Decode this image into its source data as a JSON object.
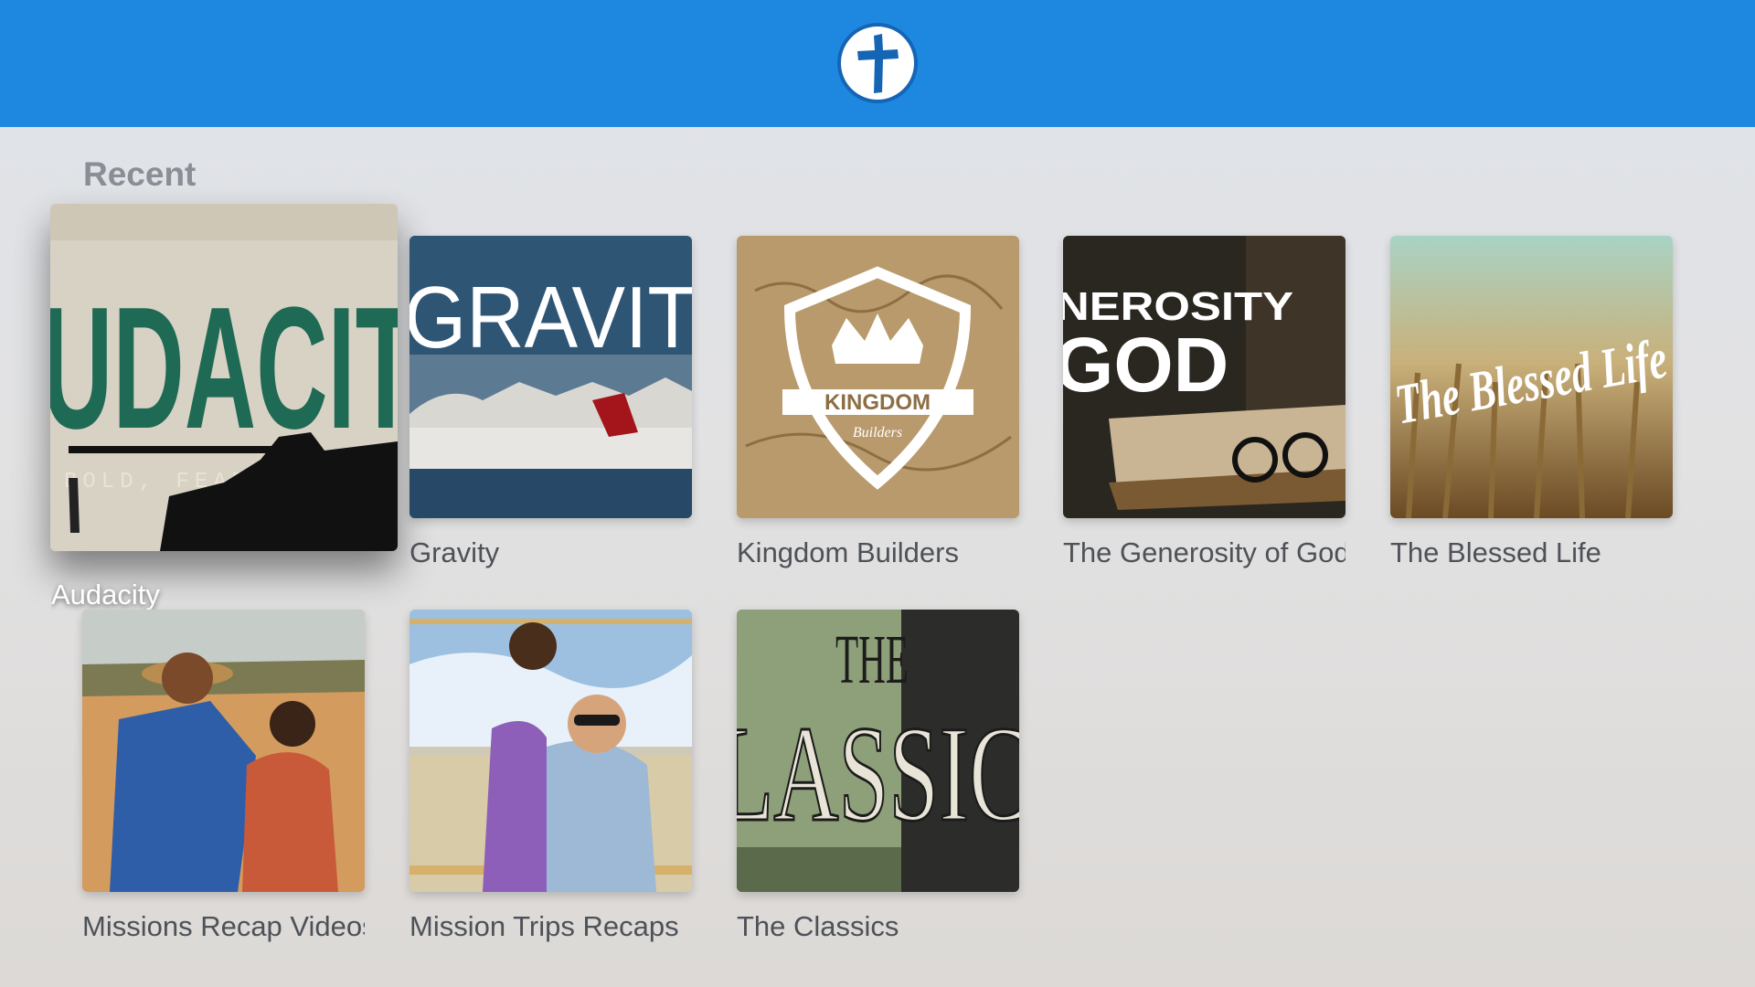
{
  "header": {
    "logo_icon": "cross-circle-icon",
    "brand_color": "#1e88e0"
  },
  "section": {
    "title": "Recent"
  },
  "items": [
    {
      "title": "Audacity",
      "art_text": "UDACIT",
      "art_subtext": "BOLD, FEARLESS, AND B",
      "focused": true
    },
    {
      "title": "Gravity",
      "art_text": "GRAVIT"
    },
    {
      "title": "Kingdom Builders",
      "art_text": "KINGDOM",
      "art_subtext": "Builders"
    },
    {
      "title": "The Generosity of God",
      "art_text": "NEROSITY",
      "art_subtext": "GOD"
    },
    {
      "title": "The Blessed Life",
      "art_text": "The Blessed Life"
    },
    {
      "title": "Missions Recap Videos"
    },
    {
      "title": "Mission Trips Recaps"
    },
    {
      "title": "The Classics",
      "art_text": "THE",
      "art_subtext": "LASSIC"
    }
  ]
}
